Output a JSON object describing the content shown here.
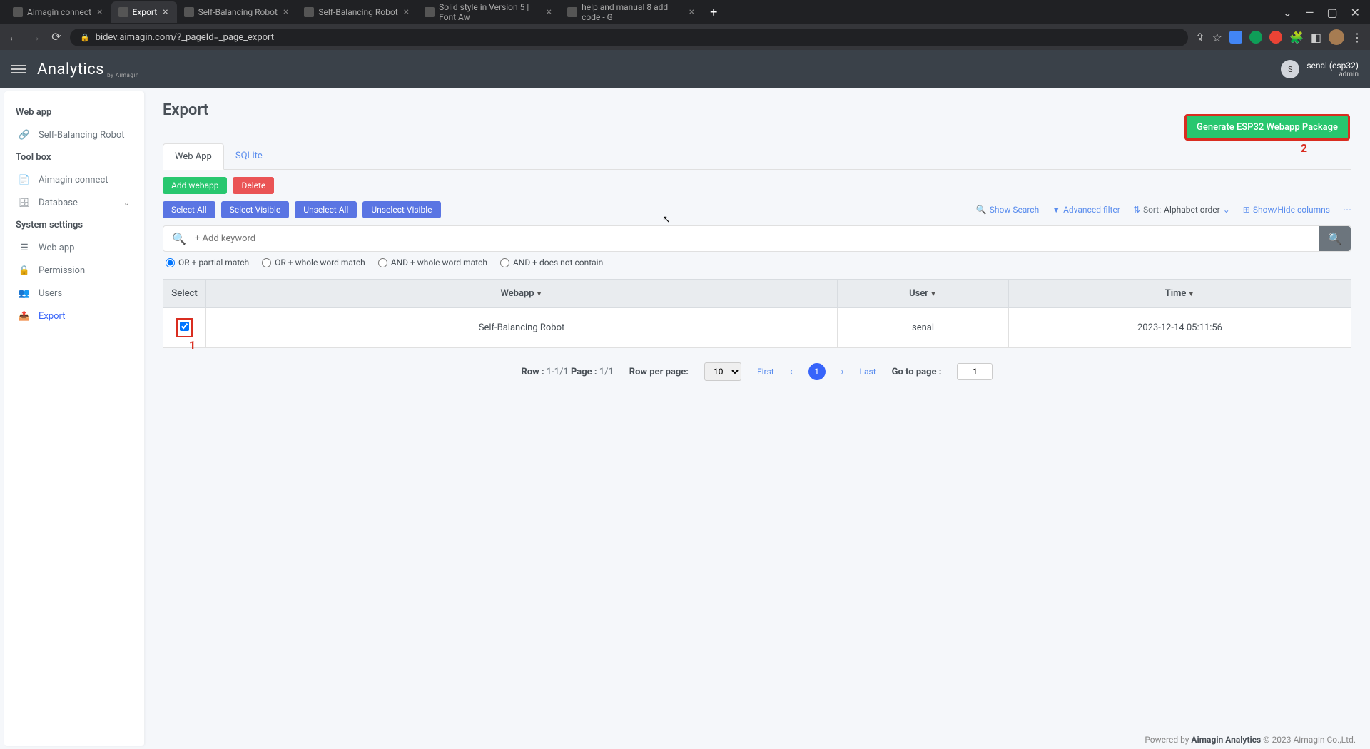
{
  "browser": {
    "tabs": [
      {
        "label": "Aimagin connect",
        "active": false
      },
      {
        "label": "Export",
        "active": true
      },
      {
        "label": "Self-Balancing Robot",
        "active": false
      },
      {
        "label": "Self-Balancing Robot",
        "active": false
      },
      {
        "label": "Solid style in Version 5 | Font Aw",
        "active": false
      },
      {
        "label": "help and manual 8 add code - G",
        "active": false
      }
    ],
    "url": "bidev.aimagin.com/?_pageId=_page_export"
  },
  "header": {
    "logo_primary": "Analytics",
    "logo_sub": "by Aimagin",
    "user_name": "senal (esp32)",
    "user_role": "admin",
    "avatar_letter": "S"
  },
  "sidebar": {
    "sections": [
      {
        "title": "Web app",
        "items": [
          {
            "label": "Self-Balancing Robot",
            "icon": "link"
          }
        ]
      },
      {
        "title": "Tool box",
        "items": [
          {
            "label": "Aimagin connect",
            "icon": "file"
          },
          {
            "label": "Database",
            "icon": "db",
            "chevron": true
          }
        ]
      },
      {
        "title": "System settings",
        "items": [
          {
            "label": "Web app",
            "icon": "layers"
          },
          {
            "label": "Permission",
            "icon": "lock"
          },
          {
            "label": "Users",
            "icon": "users"
          },
          {
            "label": "Export",
            "icon": "export",
            "active": true
          }
        ]
      }
    ]
  },
  "page": {
    "title": "Export",
    "generate_button": "Generate ESP32 Webapp Package",
    "tabs": [
      {
        "label": "Web App",
        "active": true
      },
      {
        "label": "SQLite",
        "active": false
      }
    ],
    "action_buttons": {
      "add": "Add webapp",
      "delete": "Delete"
    },
    "select_buttons": [
      "Select All",
      "Select Visible",
      "Unselect All",
      "Unselect Visible"
    ],
    "toolbar": {
      "show_search": "Show Search",
      "advanced_filter": "Advanced filter",
      "sort_label": "Sort:",
      "sort_value": "Alphabet order",
      "show_hide": "Show/Hide columns"
    },
    "search": {
      "placeholder": "+ Add keyword"
    },
    "match_options": [
      "OR + partial match",
      "OR + whole word match",
      "AND + whole word match",
      "AND + does not contain"
    ],
    "match_selected": 0,
    "table": {
      "headers": [
        "Select",
        "Webapp",
        "User",
        "Time"
      ],
      "rows": [
        {
          "selected": true,
          "webapp": "Self-Balancing Robot",
          "user": "senal",
          "time": "2023-12-14 05:11:56"
        }
      ]
    },
    "pagination": {
      "row_label": "Row :",
      "row_value": "1-1/1",
      "page_label": "Page :",
      "page_value": "1/1",
      "rpp_label": "Row per page:",
      "rpp_value": "10",
      "first": "First",
      "last": "Last",
      "go_label": "Go to page :",
      "go_value": "1",
      "current": "1"
    },
    "annotations": {
      "one": "1",
      "two": "2"
    }
  },
  "footer": {
    "prefix": "Powered by ",
    "brand": "Aimagin Analytics",
    "suffix": " © 2023 Aimagin Co.,Ltd."
  }
}
